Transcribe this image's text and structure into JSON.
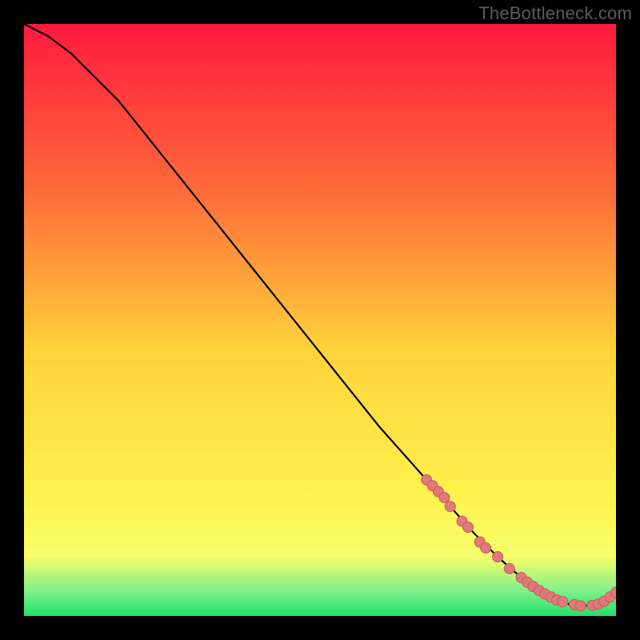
{
  "attribution": "TheBottleneck.com",
  "colors": {
    "background": "#000000",
    "gradient_top": "#ff1a3f",
    "gradient_mid_upper": "#ff7a3a",
    "gradient_mid": "#ffe23a",
    "gradient_lower": "#f7ff6a",
    "gradient_green": "#22e06a",
    "curve": "#000000",
    "dot_fill": "#e07a7a",
    "dot_stroke": "#c85a5a"
  },
  "chart_data": {
    "type": "line",
    "title": "",
    "xlabel": "",
    "ylabel": "",
    "xlim": [
      0,
      100
    ],
    "ylim": [
      0,
      100
    ],
    "grid": false,
    "series": [
      {
        "name": "bottleneck-curve",
        "x": [
          0,
          4,
          8,
          12,
          16,
          20,
          24,
          28,
          32,
          36,
          40,
          44,
          48,
          52,
          56,
          60,
          64,
          68,
          72,
          76,
          80,
          84,
          86,
          88,
          90,
          92,
          94,
          96,
          98,
          100
        ],
        "values": [
          100,
          98,
          95,
          91,
          87,
          82,
          77,
          72,
          67,
          62,
          57,
          52,
          47,
          42,
          37,
          32,
          27.5,
          23,
          18.5,
          14,
          10,
          6.5,
          5,
          3.7,
          2.7,
          2.0,
          1.7,
          1.8,
          2.5,
          4.0
        ]
      }
    ],
    "markers": {
      "name": "highlight-dots",
      "x": [
        68,
        69,
        70,
        71,
        72,
        74,
        75,
        77,
        78,
        80,
        82,
        84,
        85,
        86,
        87,
        88,
        89,
        90,
        91,
        93,
        94,
        96,
        97,
        98,
        99,
        100
      ],
      "values": [
        23,
        22,
        21,
        20,
        18.5,
        16,
        15,
        12.5,
        11.5,
        10,
        8,
        6.5,
        5.7,
        5.0,
        4.3,
        3.7,
        3.2,
        2.7,
        2.4,
        1.9,
        1.7,
        1.8,
        2.0,
        2.5,
        3.2,
        4.0
      ]
    }
  }
}
